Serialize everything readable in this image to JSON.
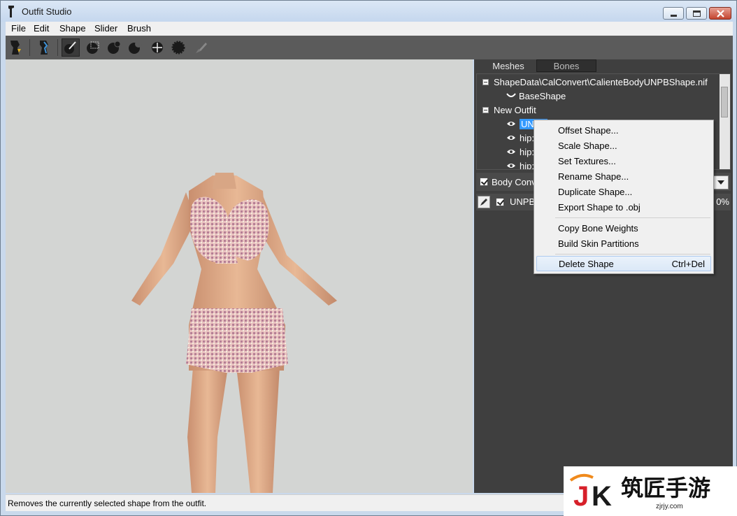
{
  "window": {
    "title": "Outfit Studio"
  },
  "menubar": {
    "items": [
      "File",
      "Edit",
      "Shape",
      "Slider",
      "Brush"
    ]
  },
  "toolbar": {
    "tools": [
      {
        "icon": "outfit-icon"
      },
      {
        "icon": "reference-icon"
      },
      {
        "icon": "select-brush-icon",
        "active": true
      },
      {
        "icon": "mask-brush-icon"
      },
      {
        "icon": "inflate-brush-icon"
      },
      {
        "icon": "deflate-brush-icon"
      },
      {
        "icon": "move-brush-icon"
      },
      {
        "icon": "smooth-brush-icon"
      },
      {
        "icon": "weight-brush-icon"
      }
    ]
  },
  "panel": {
    "tabs": [
      "Meshes",
      "Bones"
    ],
    "tree": {
      "reference_file": "ShapeData\\CalConvert\\CalienteBodyUNPBShape.nif",
      "reference_shape": "BaseShape",
      "outfit": "New Outfit",
      "shapes": [
        "UNPB",
        "hip:",
        "hip:",
        "hip:"
      ]
    },
    "slider_set": "Body Conv",
    "slider_name": "UNPB",
    "slider_value": "0%"
  },
  "context_menu": {
    "items": [
      {
        "label": "Offset Shape..."
      },
      {
        "label": "Scale Shape..."
      },
      {
        "label": "Set Textures..."
      },
      {
        "label": "Rename Shape..."
      },
      {
        "label": "Duplicate Shape..."
      },
      {
        "label": "Export Shape to .obj"
      },
      {
        "label": "Copy Bone Weights"
      },
      {
        "label": "Build Skin Partitions"
      },
      {
        "label": "Delete Shape",
        "shortcut": "Ctrl+Del"
      }
    ]
  },
  "statusbar": {
    "text": "Removes the currently selected shape from the outfit."
  },
  "watermark": {
    "logo": "JK",
    "text": "筑匠手游",
    "url": "zjrjy.com"
  }
}
